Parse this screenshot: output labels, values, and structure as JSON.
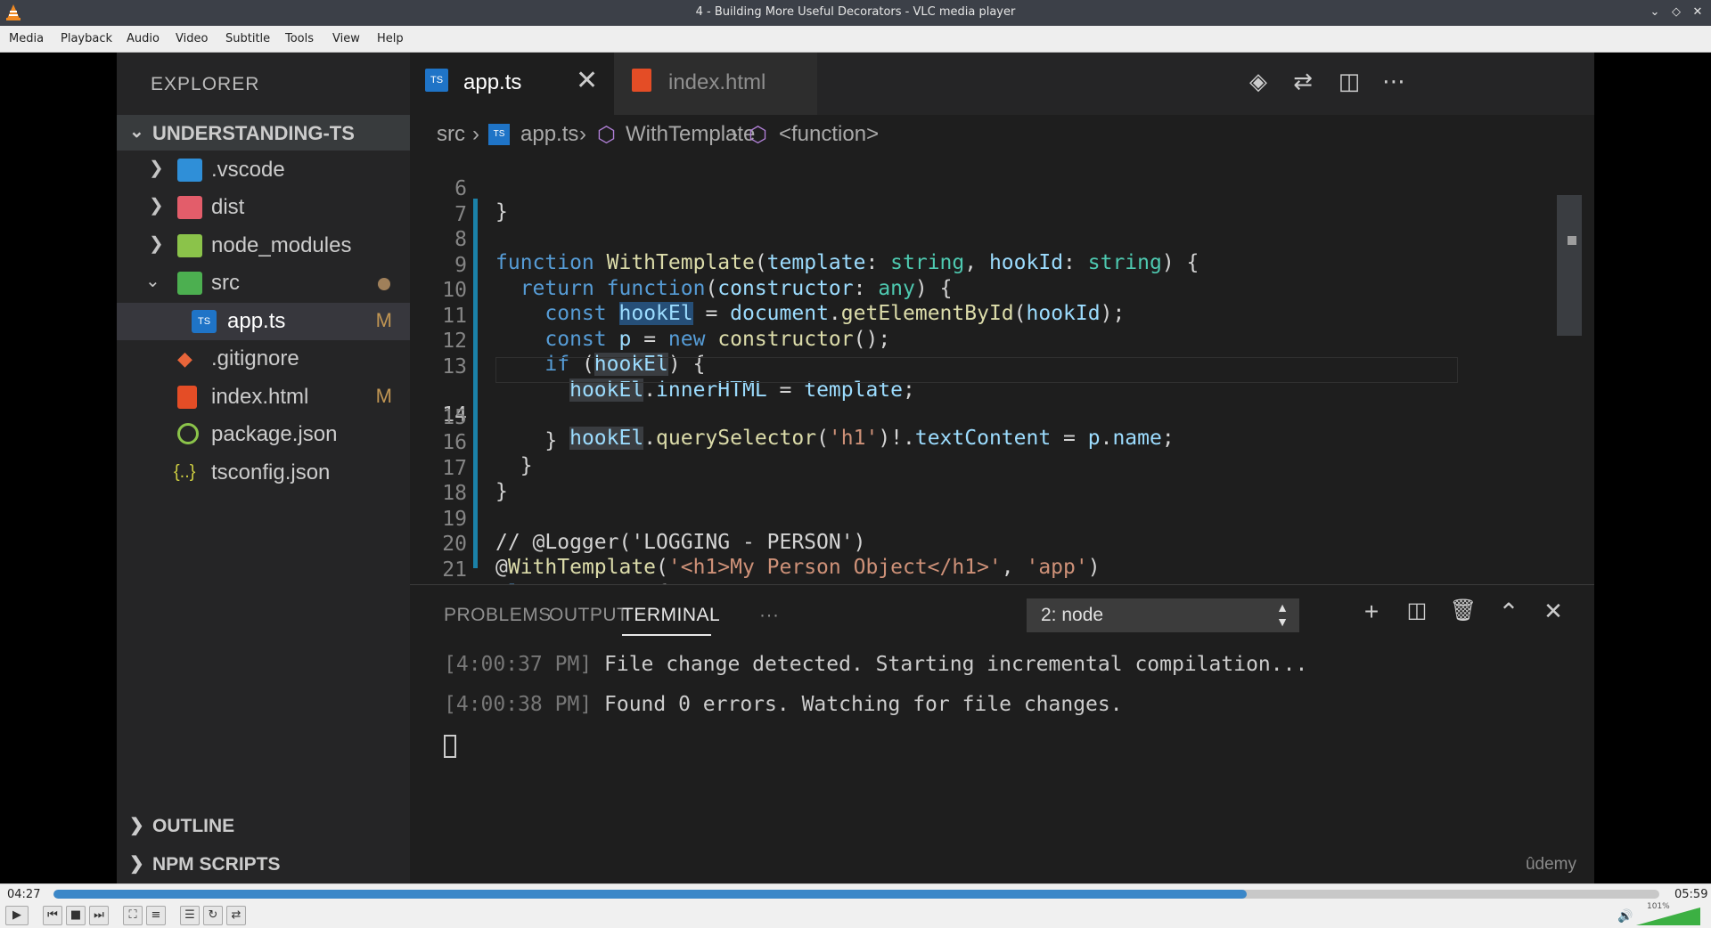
{
  "window": {
    "title": "4 - Building More Useful Decorators - VLC media player",
    "controls": [
      "minimize",
      "restore",
      "close"
    ]
  },
  "menu": [
    "Media",
    "Playback",
    "Audio",
    "Video",
    "Subtitle",
    "Tools",
    "View",
    "Help"
  ],
  "vscode": {
    "explorer_title": "EXPLORER",
    "project": "UNDERSTANDING-TS",
    "tree": [
      {
        "label": ".vscode",
        "type": "folder",
        "expanded": false,
        "icon": "vscode-folder-icon"
      },
      {
        "label": "dist",
        "type": "folder",
        "expanded": false,
        "icon": "dist-folder-icon"
      },
      {
        "label": "node_modules",
        "type": "folder",
        "expanded": false,
        "icon": "node-folder-icon"
      },
      {
        "label": "src",
        "type": "folder",
        "expanded": true,
        "icon": "src-folder-icon",
        "modified_dot": true
      },
      {
        "label": "app.ts",
        "type": "file",
        "badge": "M",
        "selected": true,
        "icon": "typescript-icon"
      },
      {
        "label": ".gitignore",
        "type": "file",
        "icon": "git-icon"
      },
      {
        "label": "index.html",
        "type": "file",
        "badge": "M",
        "icon": "html5-icon"
      },
      {
        "label": "package.json",
        "type": "file",
        "icon": "npm-icon"
      },
      {
        "label": "tsconfig.json",
        "type": "file",
        "icon": "json-icon"
      }
    ],
    "sections": [
      "OUTLINE",
      "NPM SCRIPTS"
    ],
    "tabs": [
      {
        "label": "app.ts",
        "active": true
      },
      {
        "label": "index.html",
        "active": false
      }
    ],
    "breadcrumb": [
      "src",
      "app.ts",
      "WithTemplate",
      "<function>"
    ],
    "code": {
      "current_line": 14,
      "lines": [
        {
          "n": "6",
          "text": "}"
        },
        {
          "n": "7",
          "text": ""
        },
        {
          "n": "8",
          "text": "function WithTemplate(template: string, hookId: string) {"
        },
        {
          "n": "9",
          "text": "  return function(constructor: any) {"
        },
        {
          "n": "10",
          "text": "    const hookEl = document.getElementById(hookId);"
        },
        {
          "n": "11",
          "text": "    const p = new constructor();"
        },
        {
          "n": "12",
          "text": "    if (hookEl) {"
        },
        {
          "n": "13",
          "text": "      hookEl.innerHTML = template;"
        },
        {
          "n": "14",
          "text": "      hookEl.querySelector('h1')!.textContent = p.name;"
        },
        {
          "n": "15",
          "text": "    }"
        },
        {
          "n": "16",
          "text": "  }"
        },
        {
          "n": "17",
          "text": "}"
        },
        {
          "n": "18",
          "text": ""
        },
        {
          "n": "19",
          "text": "// @Logger('LOGGING - PERSON')"
        },
        {
          "n": "20",
          "text": "@WithTemplate('<h1>My Person Object</h1>', 'app')"
        },
        {
          "n": "21",
          "text": "class Person {"
        }
      ]
    },
    "panel": {
      "tabs": [
        "PROBLEMS",
        "OUTPUT",
        "TERMINAL",
        "···"
      ],
      "active_tab": "TERMINAL",
      "terminal_select": "2: node",
      "terminal_lines": [
        {
          "ts": "[4:00:37 PM]",
          "msg": " File change detected. Starting incremental compilation..."
        },
        {
          "ts": "[4:00:38 PM]",
          "msg": " Found 0 errors. Watching for file changes."
        }
      ]
    },
    "watermark": "ûdemy"
  },
  "player": {
    "elapsed": "04:27",
    "total": "05:59",
    "progress": 0.743,
    "volume_label": "101%",
    "volume": 1.01
  }
}
